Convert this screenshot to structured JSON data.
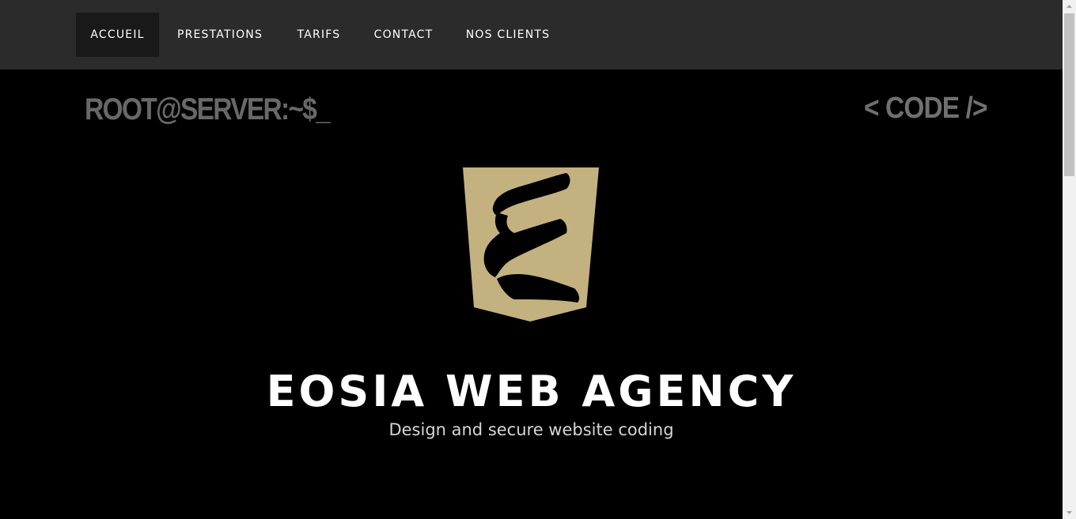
{
  "nav": {
    "items": [
      {
        "label": "ACCUEIL",
        "active": true
      },
      {
        "label": "PRESTATIONS",
        "active": false
      },
      {
        "label": "TARIFS",
        "active": false
      },
      {
        "label": "CONTACT",
        "active": false
      },
      {
        "label": "NOS CLIENTS",
        "active": false
      }
    ]
  },
  "hero": {
    "prompt_text": "ROOT@SERVER:~$_",
    "code_text": "< CODE />",
    "logo_icon": "eosia-e-shield-logo",
    "title": "EOSIA WEB AGENCY",
    "subtitle": "Design and secure website coding"
  },
  "colors": {
    "navbar_bg": "#2b2b2b",
    "nav_active_bg": "#191919",
    "page_bg": "#000000",
    "logo_gold": "#c3b17f",
    "title_white": "#ffffff",
    "deco_gray": "#686868"
  }
}
